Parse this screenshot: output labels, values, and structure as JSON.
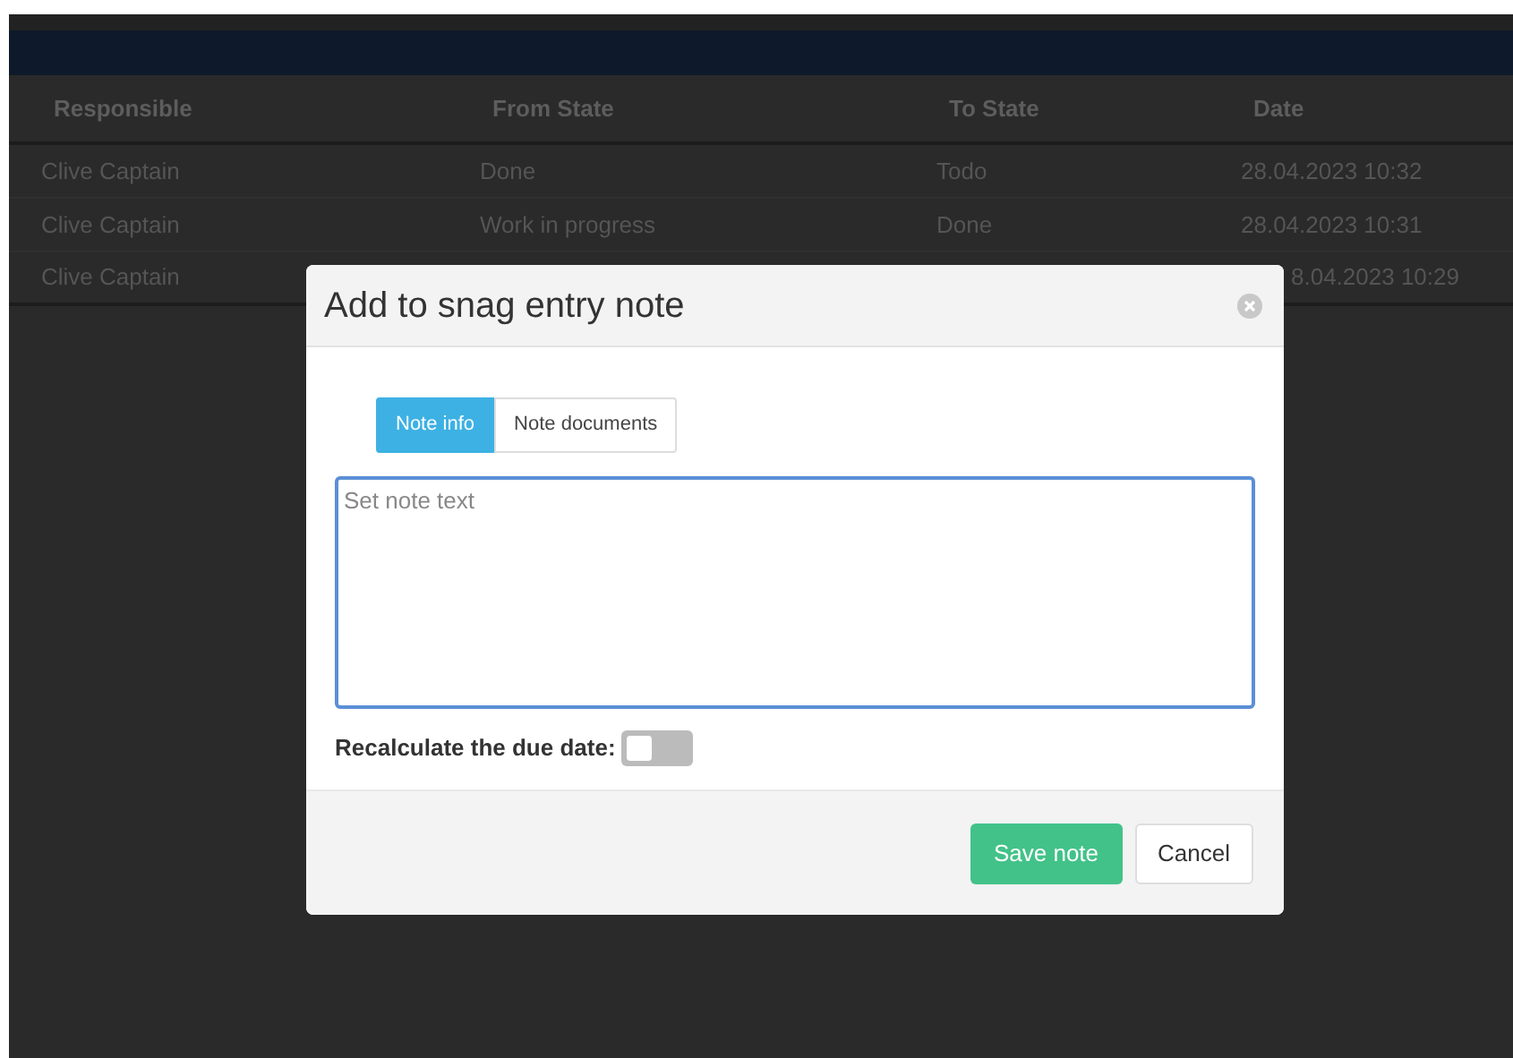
{
  "table": {
    "columns": [
      "Responsible",
      "From State",
      "To State",
      "Date"
    ],
    "rows": [
      [
        "Clive Captain",
        "Done",
        "Todo",
        "28.04.2023 10:32"
      ],
      [
        "Clive Captain",
        "Work in progress",
        "Done",
        "28.04.2023 10:31"
      ],
      [
        "Clive Captain",
        "",
        "",
        "8.04.2023 10:29"
      ]
    ]
  },
  "dialog": {
    "title": "Add to snag entry note",
    "tabs": [
      {
        "label": "Note info",
        "selected": true
      },
      {
        "label": "Note documents",
        "selected": false
      }
    ],
    "note": {
      "placeholder": "Set note text"
    },
    "recalculate": {
      "label": "Recalculate the due date:",
      "checked": false
    },
    "buttons": [
      {
        "label": "Save note",
        "kind": "primary"
      },
      {
        "label": "Cancel",
        "kind": "secondary"
      }
    ]
  }
}
